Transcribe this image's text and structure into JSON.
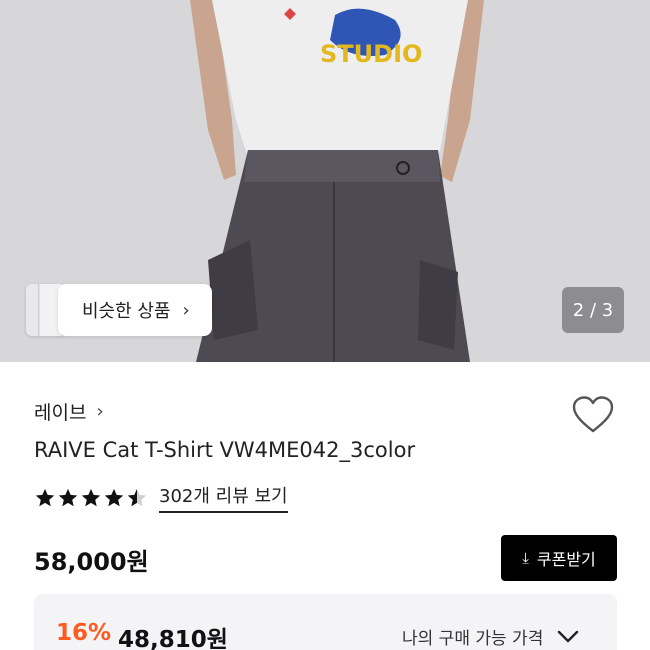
{
  "image": {
    "similar_label": "비슷한 상품",
    "pager": "2 / 3"
  },
  "product": {
    "brand": "레이브",
    "title": "RAIVE Cat T-Shirt VW4ME042_3color",
    "rating": 4.5,
    "review_link": "302개 리뷰 보기",
    "price": "58,000원",
    "coupon_label": "쿠폰받기",
    "discount_percent": "16%",
    "discount_price": "48,810원",
    "my_price_label": "나의 구매 가능 가격"
  },
  "colors": {
    "discount": "#ff5a1f",
    "star": "#111111",
    "coupon_bg": "#000000"
  },
  "icons": [
    "chevron-right-icon",
    "heart-icon",
    "star-icon",
    "download-icon",
    "chevron-down-icon"
  ]
}
